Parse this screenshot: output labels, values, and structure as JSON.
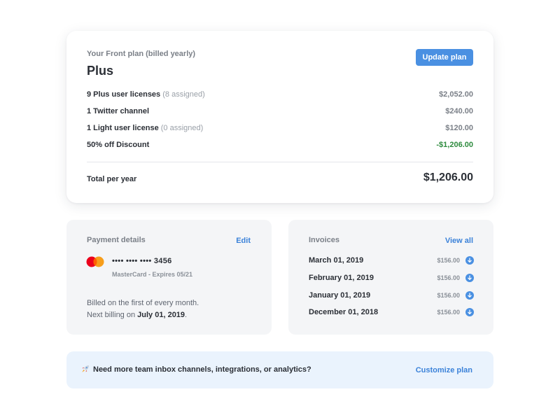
{
  "plan": {
    "subtitle": "Your Front plan (billed yearly)",
    "name": "Plus",
    "update_button": "Update plan",
    "line_items": [
      {
        "label": "9 Plus user licenses",
        "note": "(8 assigned)",
        "amount": "$2,052.00",
        "discount": false
      },
      {
        "label": "1 Twitter channel",
        "note": "",
        "amount": "$240.00",
        "discount": false
      },
      {
        "label": "1 Light user license",
        "note": "(0 assigned)",
        "amount": "$120.00",
        "discount": false
      },
      {
        "label": "50% off Discount",
        "note": "",
        "amount": "-$1,206.00",
        "discount": true
      }
    ],
    "total_label": "Total per year",
    "total_amount": "$1,206.00"
  },
  "payment": {
    "title": "Payment details",
    "edit_link": "Edit",
    "card_number": "•••• •••• •••• 3456",
    "card_expiry": "MasterCard - Expires 05/21",
    "billing_line1": "Billed on the first of every month.",
    "billing_line2_prefix": "Next billing on",
    "billing_date": "July 01, 2019",
    "billing_line2_suffix": ".",
    "card_icon": "mastercard-logo"
  },
  "invoices": {
    "title": "Invoices",
    "view_all_link": "View all",
    "download_icon": "download-arrow-icon",
    "items": [
      {
        "date": "March 01, 2019",
        "amount": "$156.00"
      },
      {
        "date": "February 01, 2019",
        "amount": "$156.00"
      },
      {
        "date": "January 01, 2019",
        "amount": "$156.00"
      },
      {
        "date": "December 01, 2018",
        "amount": "$156.00"
      }
    ]
  },
  "banner": {
    "icon": "rocket-icon",
    "text": "Need more team inbox channels, integrations, or analytics?",
    "link": "Customize plan"
  },
  "colors": {
    "accent": "#4a90e2",
    "link": "#3b82d9",
    "discount": "#2e8b3e",
    "panel_bg": "#f4f5f7",
    "banner_bg": "#eaf3fd"
  }
}
